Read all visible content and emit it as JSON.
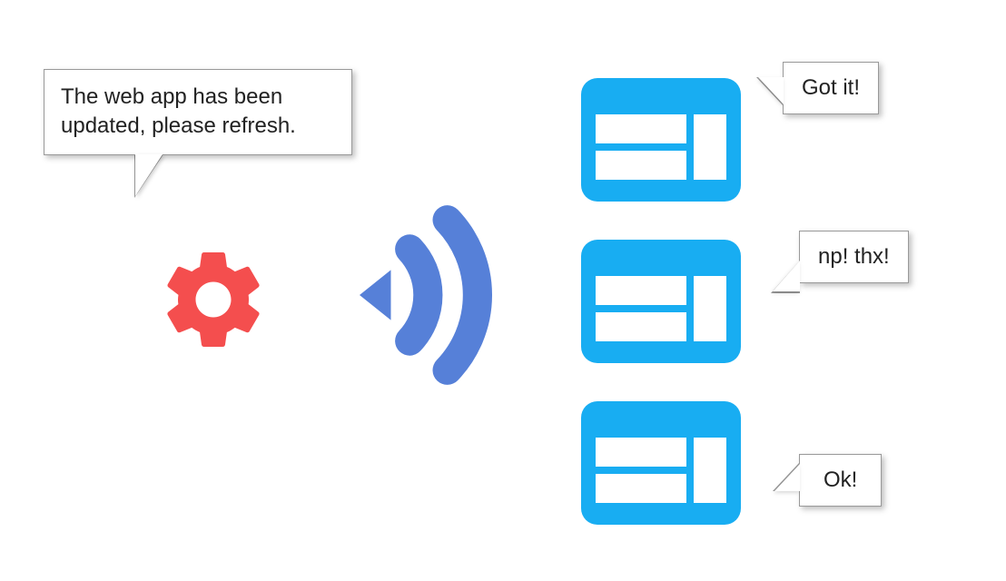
{
  "colors": {
    "gear": "#F44E4E",
    "broadcast": "#5680D8",
    "window": "#18ADF2"
  },
  "serviceWorker": {
    "message": "The web app has been updated, please refresh."
  },
  "clients": [
    {
      "reply": "Got it!"
    },
    {
      "reply": "np! thx!"
    },
    {
      "reply": "Ok!"
    }
  ]
}
